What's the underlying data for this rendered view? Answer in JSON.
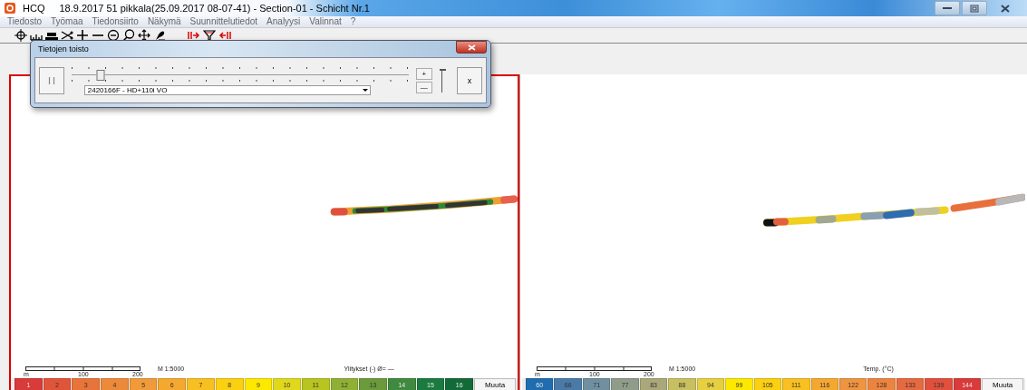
{
  "window": {
    "app": "HCQ",
    "title": "18.9.2017 51 pikkala(25.09.2017 08-07-41) - Section-01 - Schicht Nr.1"
  },
  "menu": [
    "Tiedosto",
    "Työmaa",
    "Tiedonsiirto",
    "Näkymä",
    "Suunnittelutiedot",
    "Analyysi",
    "Valinnat",
    "?"
  ],
  "dialog": {
    "title": "Tietojen toisto",
    "position": {
      "level": 0.086
    },
    "speed": {
      "level": 1
    },
    "plus": "+",
    "minus": "—",
    "stop": "x",
    "vehicle": "2420166F - HD+110i VO"
  },
  "panels": [
    {
      "selected": true,
      "kind": "passes",
      "scale": {
        "unit": "m",
        "mid": "100",
        "end": "200",
        "ratio": "M 1:5000"
      },
      "legend_title": "Ylitykset (-) Ø= —",
      "button": "Muuta",
      "legend": [
        {
          "label": "1",
          "color": "#d93a3a"
        },
        {
          "label": "2",
          "color": "#e0553a"
        },
        {
          "label": "3",
          "color": "#e8743a"
        },
        {
          "label": "4",
          "color": "#ec8a3a"
        },
        {
          "label": "5",
          "color": "#f09a3a"
        },
        {
          "label": "6",
          "color": "#f5a830"
        },
        {
          "label": "7",
          "color": "#f8bf20"
        },
        {
          "label": "8",
          "color": "#fbd010"
        },
        {
          "label": "9",
          "color": "#fde800"
        },
        {
          "label": "10",
          "color": "#e0d81a"
        },
        {
          "label": "11",
          "color": "#b8c420"
        },
        {
          "label": "12",
          "color": "#8fb035"
        },
        {
          "label": "13",
          "color": "#6a9a3a"
        },
        {
          "label": "14",
          "color": "#3f8a3e"
        },
        {
          "label": "15",
          "color": "#1a7a40"
        },
        {
          "label": "16",
          "color": "#126a38"
        }
      ]
    },
    {
      "selected": false,
      "kind": "temperature",
      "scale": {
        "unit": "m",
        "mid": "100",
        "end": "200",
        "ratio": "M 1:5000"
      },
      "legend_title": "Temp. (°C)",
      "button": "Muuta",
      "legend": [
        {
          "label": "60",
          "color": "#1f6db0"
        },
        {
          "label": "66",
          "color": "#4a7aa8"
        },
        {
          "label": "71",
          "color": "#7090a0"
        },
        {
          "label": "77",
          "color": "#909c8a"
        },
        {
          "label": "83",
          "color": "#aaa87a"
        },
        {
          "label": "88",
          "color": "#c8c060"
        },
        {
          "label": "94",
          "color": "#e6d040"
        },
        {
          "label": "99",
          "color": "#fde800"
        },
        {
          "label": "105",
          "color": "#fbd010"
        },
        {
          "label": "111",
          "color": "#f8c020"
        },
        {
          "label": "116",
          "color": "#f5a830"
        },
        {
          "label": "122",
          "color": "#ef9440"
        },
        {
          "label": "128",
          "color": "#ec8440"
        },
        {
          "label": "133",
          "color": "#e66a40"
        },
        {
          "label": "139",
          "color": "#e0503c"
        },
        {
          "label": "144",
          "color": "#d93a3a"
        }
      ]
    }
  ]
}
